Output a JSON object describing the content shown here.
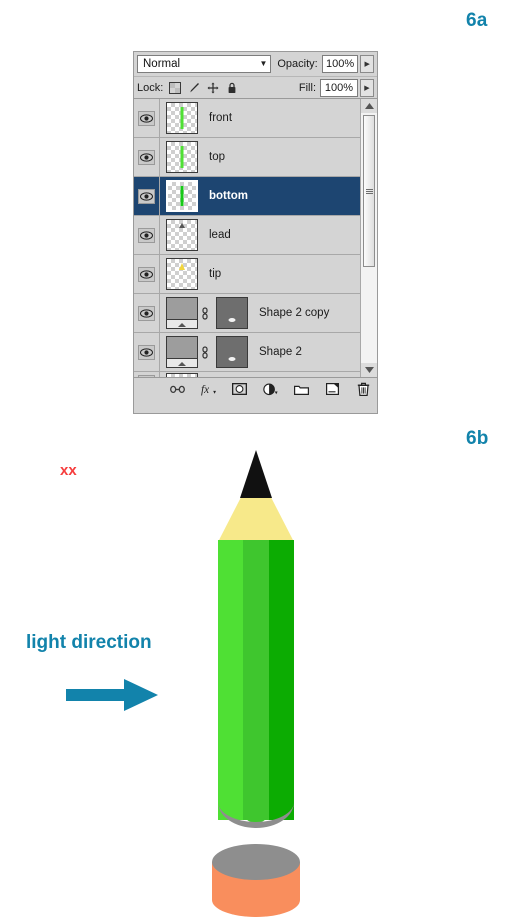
{
  "figure_labels": {
    "a": "6a",
    "b": "6b"
  },
  "layers_panel": {
    "blend_mode": {
      "value": "Normal",
      "caret_icon": "chevron-down-icon"
    },
    "opacity": {
      "label": "Opacity:",
      "value": "100%",
      "spinner_icon": "chevron-right-icon"
    },
    "fill": {
      "label": "Fill:",
      "value": "100%",
      "spinner_icon": "chevron-right-icon"
    },
    "lock": {
      "label": "Lock:",
      "icons": [
        "lock-transparency-icon",
        "lock-image-brush-icon",
        "lock-position-move-icon",
        "lock-all-padlock-icon"
      ]
    },
    "rows": [
      {
        "name": "front",
        "type": "pixel",
        "visible": true,
        "selected": false,
        "thumb": "green-strip"
      },
      {
        "name": "top",
        "type": "pixel",
        "visible": true,
        "selected": false,
        "thumb": "green-strip"
      },
      {
        "name": "bottom",
        "type": "pixel",
        "visible": true,
        "selected": true,
        "thumb": "green-strip"
      },
      {
        "name": "lead",
        "type": "pixel",
        "visible": true,
        "selected": false,
        "thumb": "empty"
      },
      {
        "name": "tip",
        "type": "pixel",
        "visible": true,
        "selected": false,
        "thumb": "yellow-tip"
      },
      {
        "name": "Shape 2 copy",
        "type": "shape",
        "visible": true,
        "selected": false,
        "thumb": "gray-shape-mask"
      },
      {
        "name": "Shape 2",
        "type": "shape",
        "visible": true,
        "selected": false,
        "thumb": "gray-shape-mask"
      }
    ],
    "visibility_icon": "eye-icon",
    "link_icon": "layer-mask-link-icon",
    "scrollbar": {
      "up_icon": "scroll-up-arrow-icon",
      "down_icon": "scroll-down-arrow-icon"
    },
    "toolbar_buttons": [
      "link-layers-icon",
      "layer-style-fx-icon",
      "add-layer-mask-icon",
      "new-adjustment-layer-icon",
      "new-group-folder-icon",
      "new-layer-icon",
      "delete-layer-trash-icon"
    ]
  },
  "illustration": {
    "annotation": "xx",
    "light_direction_label": "light direction",
    "arrow_icon": "right-arrow-icon",
    "colors": {
      "lead_black": "#111111",
      "wood_yellow": "#f7e98a",
      "barrel_light_green": "#4fe034",
      "barrel_mid_green": "#3fc62e",
      "barrel_dark_green": "#0cac02",
      "shadow_gray": "#8e8e8e",
      "eraser_orange": "#f98e5d",
      "eraser_top_gray": "#8e8e8e",
      "accent_teal": "#1283ab",
      "note_red": "#f63d3d"
    }
  }
}
